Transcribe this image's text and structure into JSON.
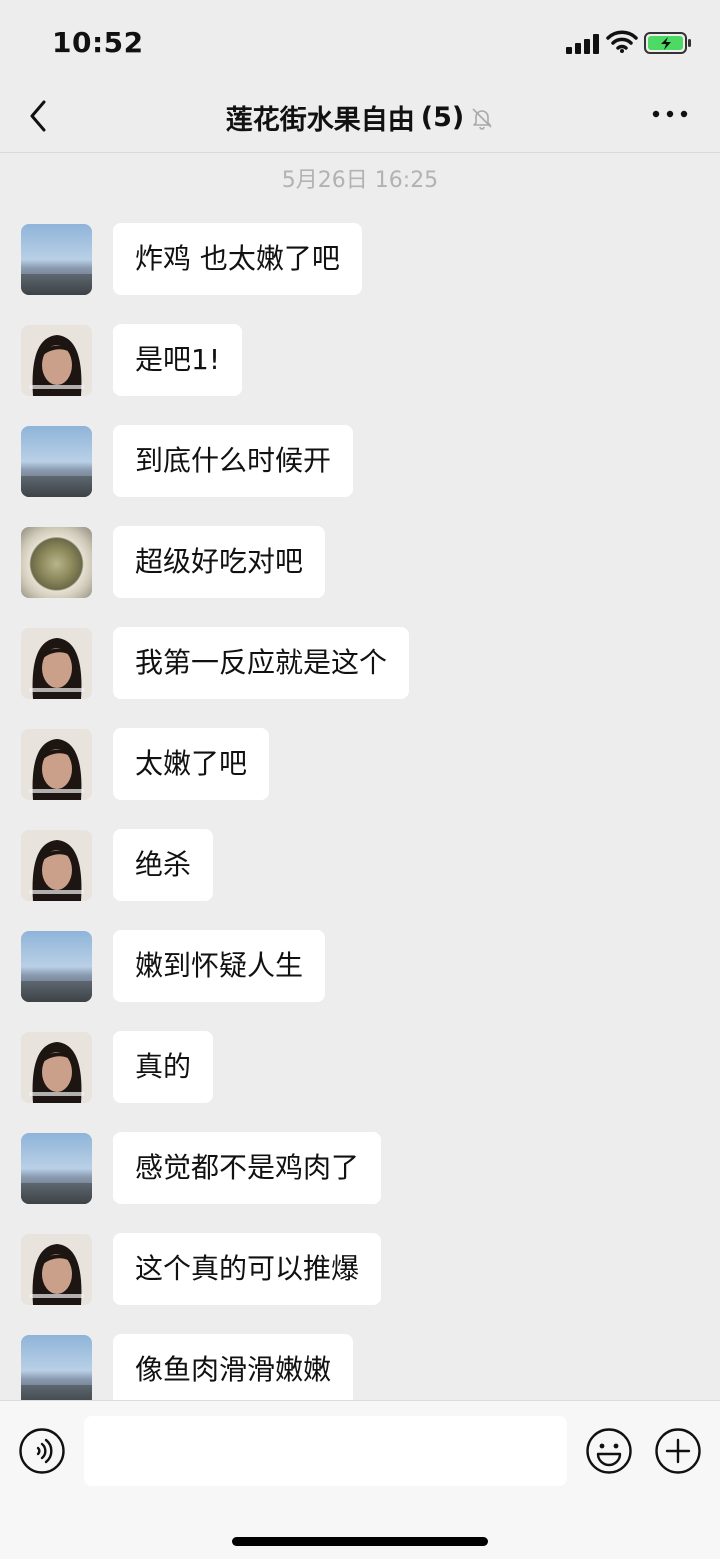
{
  "status_bar": {
    "time": "10:52"
  },
  "nav": {
    "title": "莲花街水果自由",
    "member_count": "(5)"
  },
  "timestamp": "5月26日 16:25",
  "messages": [
    {
      "text": "炸鸡 也太嫩了吧",
      "avatar": "landscape"
    },
    {
      "text": "是吧1!",
      "avatar": "woman"
    },
    {
      "text": "到底什么时候开",
      "avatar": "landscape"
    },
    {
      "text": "超级好吃对吧",
      "avatar": "tea"
    },
    {
      "text": "我第一反应就是这个",
      "avatar": "woman"
    },
    {
      "text": "太嫩了吧",
      "avatar": "woman"
    },
    {
      "text": "绝杀",
      "avatar": "woman"
    },
    {
      "text": "嫩到怀疑人生",
      "avatar": "landscape"
    },
    {
      "text": "真的",
      "avatar": "woman"
    },
    {
      "text": "感觉都不是鸡肉了",
      "avatar": "landscape"
    },
    {
      "text": "这个真的可以推爆",
      "avatar": "woman"
    },
    {
      "text": "像鱼肉滑滑嫩嫩",
      "avatar": "landscape"
    }
  ],
  "input": {
    "value": "",
    "placeholder": ""
  },
  "colors": {
    "background": "#ededed",
    "bubble": "#ffffff",
    "battery_fill": "#4cd964"
  },
  "icons": [
    "back-icon",
    "mute-bell-icon",
    "more-icon",
    "voice-icon",
    "emoji-icon",
    "plus-icon",
    "signal-icon",
    "wifi-icon",
    "battery-icon"
  ]
}
